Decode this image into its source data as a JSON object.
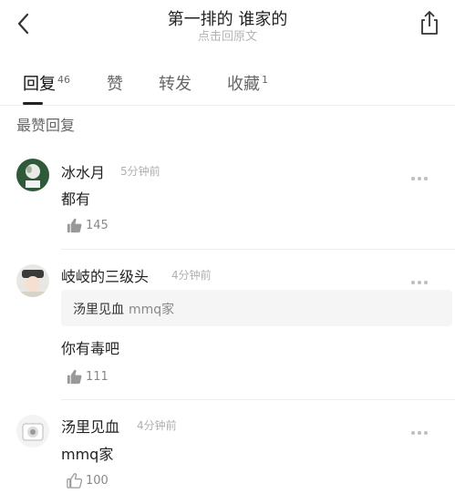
{
  "header": {
    "title": "第一排的 谁家的",
    "subtitle": "点击回原文",
    "back_icon": "chevron-left-icon",
    "share_icon": "share-icon"
  },
  "tabs": [
    {
      "label": "回复",
      "count": "46",
      "active": true
    },
    {
      "label": "赞",
      "count": "",
      "active": false
    },
    {
      "label": "转发",
      "count": "",
      "active": false
    },
    {
      "label": "收藏",
      "count": "1",
      "active": false
    }
  ],
  "section_title": "最赞回复",
  "comments": [
    {
      "name": "冰水月",
      "time": "5分钟前",
      "text": "都有",
      "likes": "145",
      "liked": true,
      "quote": null
    },
    {
      "name": "岐岐的三级头",
      "time": "4分钟前",
      "text": "你有毒吧",
      "likes": "111",
      "liked": true,
      "quote": {
        "name": "汤里见血",
        "text": "mmq家"
      }
    },
    {
      "name": "汤里见血",
      "time": "4分钟前",
      "text": "mmq家",
      "likes": "100",
      "liked": false,
      "quote": null
    }
  ],
  "colors": {
    "text": "#222222",
    "muted": "#b0b0b0",
    "divider": "#ededed",
    "quote_bg": "#f5f5f5"
  }
}
